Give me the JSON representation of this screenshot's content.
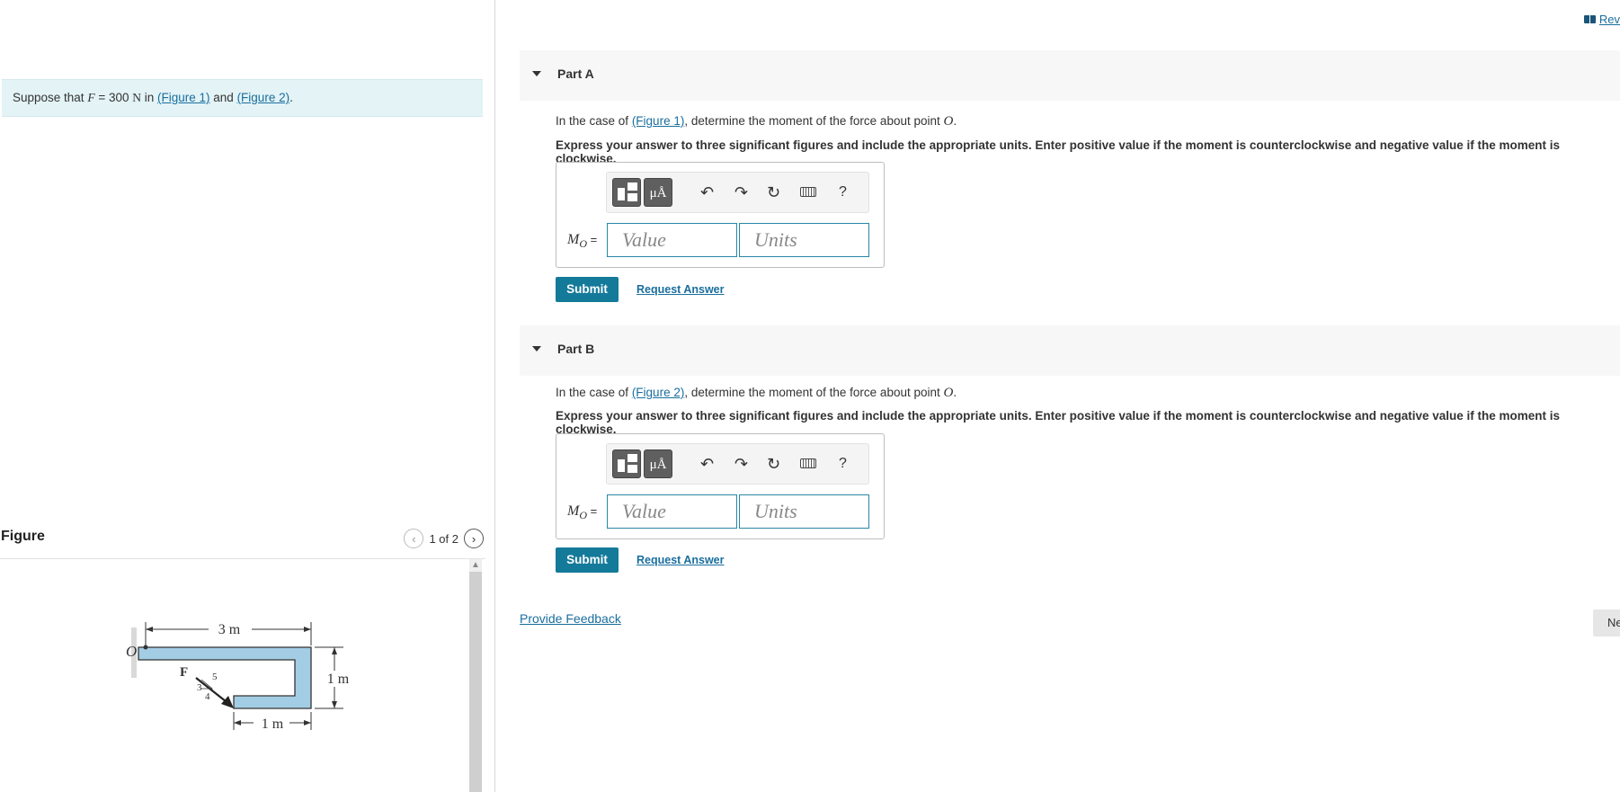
{
  "intro": {
    "prefix": "Suppose that ",
    "var_f": "F",
    "eq": " = 300 ",
    "unit": "N",
    "mid": " in ",
    "fig1_link": "(Figure 1)",
    "and": " and ",
    "fig2_link": "(Figure 2)",
    "end": "."
  },
  "figure_panel": {
    "title": "Figure",
    "pager_text": "1 of 2",
    "prev_icon": "chevron-left-icon",
    "next_icon": "chevron-right-icon"
  },
  "diagram": {
    "label_O": "O",
    "label_F": "F",
    "dim_top": "3 m",
    "dim_right": "1 m",
    "dim_bottom": "1 m",
    "slope_3": "3",
    "slope_4": "4",
    "slope_5": "5"
  },
  "header": {
    "review_label": "Rev",
    "review_icon": "book-icon"
  },
  "parts": [
    {
      "title": "Part A",
      "q_prefix": "In the case of ",
      "q_link": "(Figure 1)",
      "q_suffix": ", determine the moment of the force about point ",
      "q_point": "O",
      "q_end": ".",
      "instruction": "Express your answer to three significant figures and include the appropriate units. Enter positive value if the moment is counterclockwise and negative value if the moment is clockwise.",
      "label_main": "M",
      "label_sub": "O",
      "label_eq": " =",
      "value_placeholder": "Value",
      "units_placeholder": "Units",
      "submit_label": "Submit",
      "request_label": "Request Answer"
    },
    {
      "title": "Part B",
      "q_prefix": "In the case of ",
      "q_link": "(Figure 2)",
      "q_suffix": ", determine the moment of the force about point ",
      "q_point": "O",
      "q_end": ".",
      "instruction": "Express your answer to three significant figures and include the appropriate units. Enter positive value if the moment is counterclockwise and negative value if the moment is clockwise.",
      "label_main": "M",
      "label_sub": "O",
      "label_eq": " =",
      "value_placeholder": "Value",
      "units_placeholder": "Units",
      "submit_label": "Submit",
      "request_label": "Request Answer"
    }
  ],
  "toolbar": {
    "units_glyph": "μÅ",
    "undo_glyph": "↶",
    "redo_glyph": "↷",
    "reset_glyph": "↻",
    "help_glyph": "?"
  },
  "feedback_label": "Provide Feedback",
  "next_label": "Ne"
}
